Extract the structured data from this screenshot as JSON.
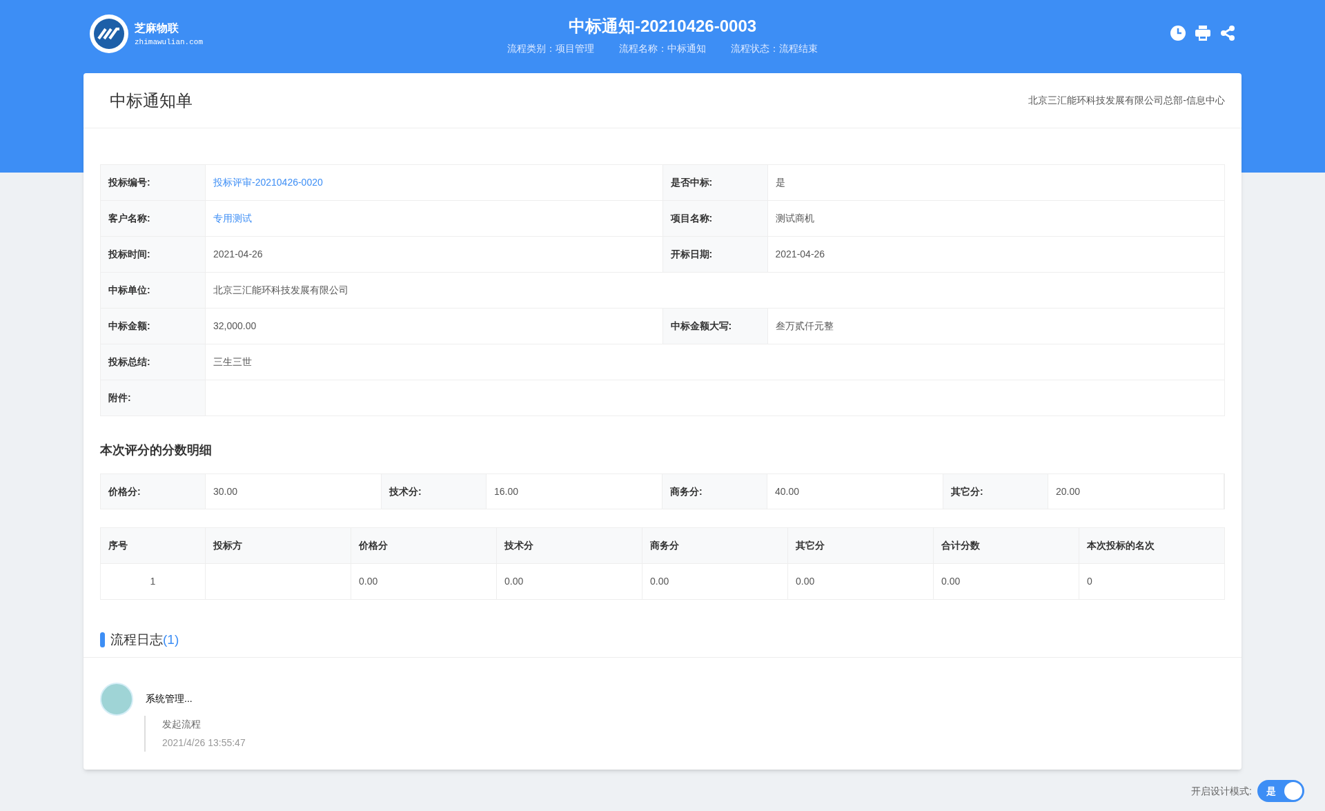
{
  "header": {
    "logo_name": "芝麻物联",
    "logo_domain": "zhimawulian.com",
    "title": "中标通知-20210426-0003",
    "meta": [
      {
        "label": "流程类别：",
        "value": "项目管理"
      },
      {
        "label": "流程名称：",
        "value": "中标通知"
      },
      {
        "label": "流程状态：",
        "value": "流程结束"
      }
    ]
  },
  "card": {
    "title": "中标通知单",
    "department": "北京三汇能环科技发展有限公司总部-信息中心"
  },
  "form_rows": [
    {
      "fields": [
        {
          "label": "投标编号:",
          "value": "投标评审-20210426-0020",
          "kind": "link"
        },
        {
          "label": "是否中标:",
          "value": "是",
          "kind": "text"
        }
      ]
    },
    {
      "fields": [
        {
          "label": "客户名称:",
          "value": "专用测试",
          "kind": "link"
        },
        {
          "label": "项目名称:",
          "value": "测试商机",
          "kind": "text"
        }
      ]
    },
    {
      "fields": [
        {
          "label": "投标时间:",
          "value": "2021-04-26",
          "kind": "text"
        },
        {
          "label": "开标日期:",
          "value": "2021-04-26",
          "kind": "text"
        }
      ]
    },
    {
      "fields": [
        {
          "label": "中标单位:",
          "value": "北京三汇能环科技发展有限公司",
          "kind": "text"
        }
      ]
    },
    {
      "fields": [
        {
          "label": "中标金额:",
          "value": "32,000.00",
          "kind": "text"
        },
        {
          "label": "中标金额大写:",
          "value": "叁万贰仟元整",
          "kind": "text"
        }
      ]
    },
    {
      "fields": [
        {
          "label": "投标总结:",
          "value": "三生三世",
          "kind": "text"
        }
      ]
    },
    {
      "fields": [
        {
          "label": "附件:",
          "kind": "text"
        }
      ]
    }
  ],
  "score_section": {
    "title": "本次评分的分数明细",
    "scores": [
      {
        "label": "价格分:",
        "value": "30.00"
      },
      {
        "label": "技术分:",
        "value": "16.00"
      },
      {
        "label": "商务分:",
        "value": "40.00"
      },
      {
        "label": "其它分:",
        "value": "20.00"
      }
    ]
  },
  "ranking_table": {
    "columns": [
      "序号",
      "投标方",
      "价格分",
      "技术分",
      "商务分",
      "其它分",
      "合计分数",
      "本次投标的名次"
    ],
    "rows": [
      [
        "1",
        "",
        "0.00",
        "0.00",
        "0.00",
        "0.00",
        "0.00",
        "0"
      ]
    ]
  },
  "process_log": {
    "title": "流程日志",
    "count": "(1)",
    "entries": [
      {
        "user": "系统管理...",
        "action": "发起流程",
        "time": "2021/4/26 13:55:47"
      }
    ]
  },
  "design_mode": {
    "label": "开启设计模式:",
    "toggle_text": "是",
    "on": true
  }
}
